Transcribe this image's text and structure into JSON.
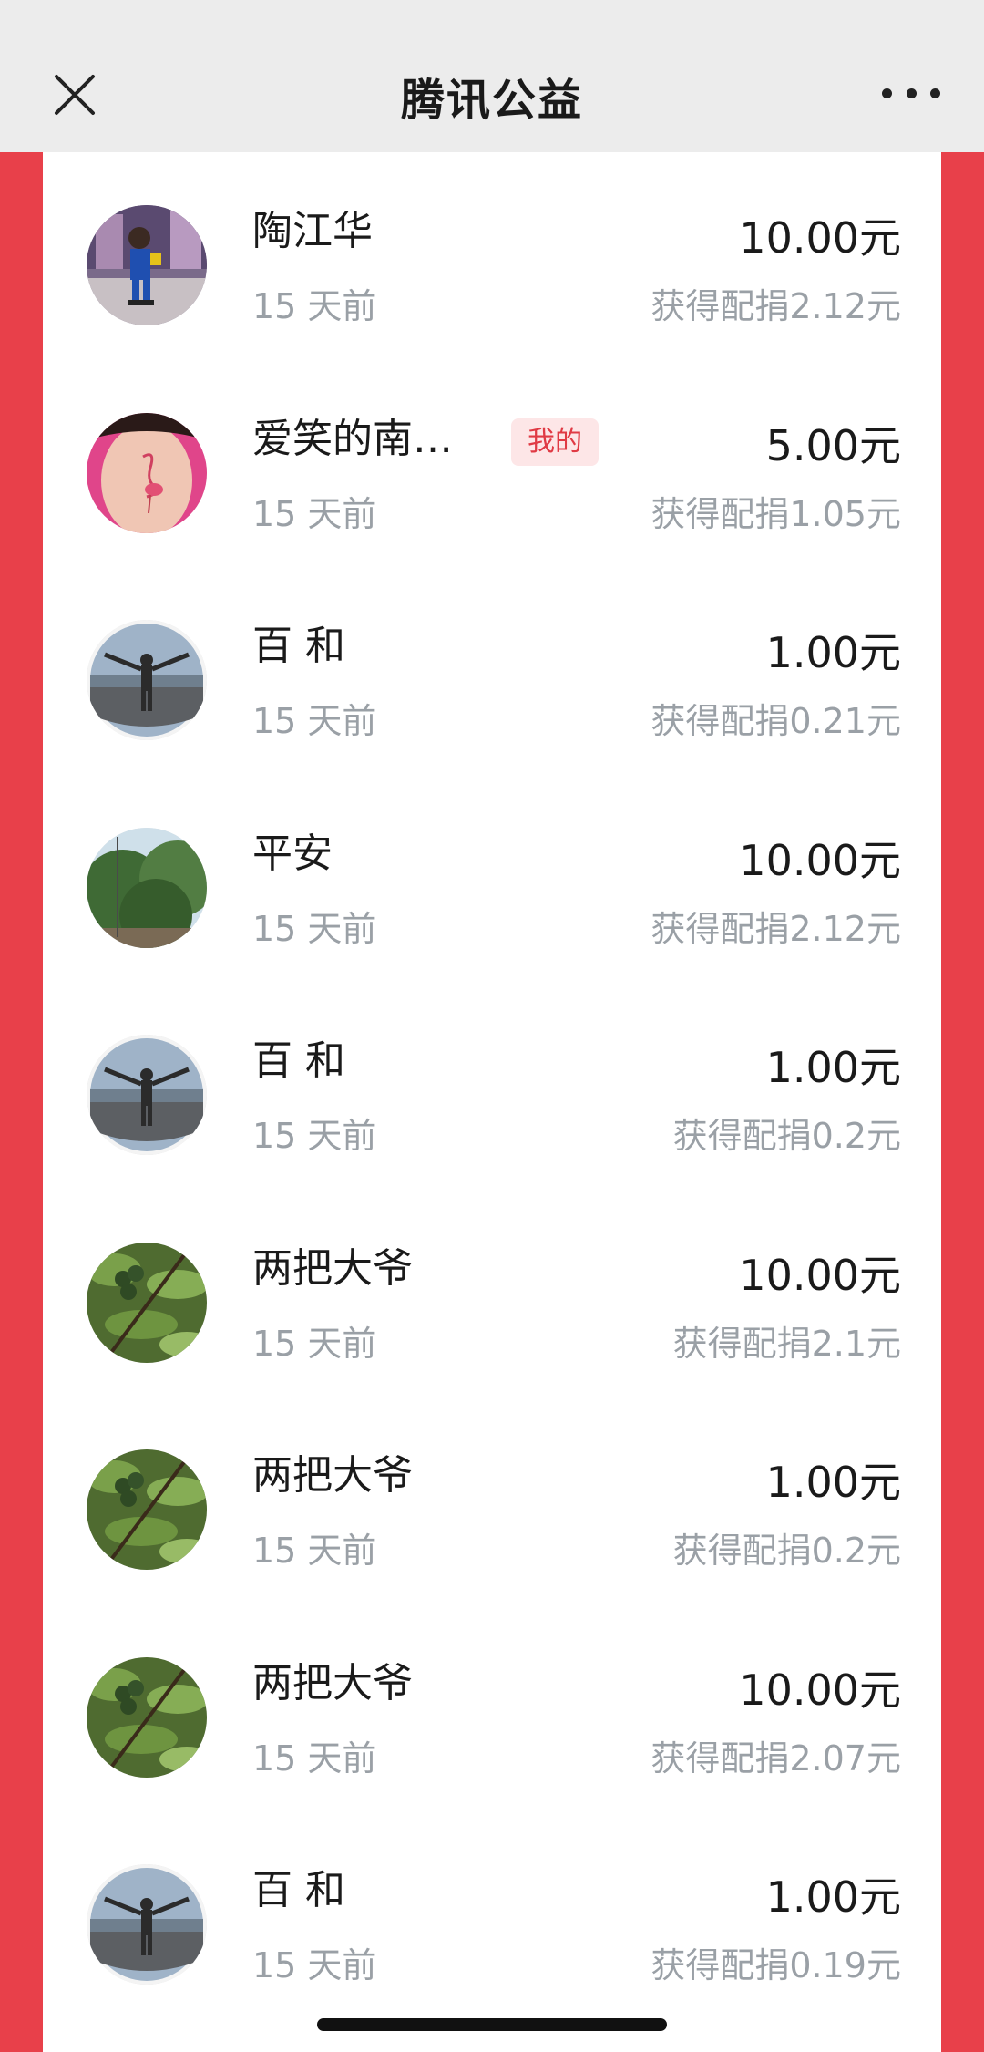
{
  "header": {
    "title": "腾讯公益",
    "close_icon": "close-icon",
    "more_icon": "more-dots-icon"
  },
  "colors": {
    "accent_red": "#e8404a",
    "badge_bg": "#fde6e7",
    "badge_text": "#e03a44",
    "muted_text": "#9aa0a6"
  },
  "donations": [
    {
      "name": "陶江华",
      "time": "15 天前",
      "amount": "10.00元",
      "match": "获得配捐2.12元",
      "badge": "",
      "avatar": "child-photo"
    },
    {
      "name": "爱笑的南…",
      "time": "15 天前",
      "amount": "5.00元",
      "match": "获得配捐1.05元",
      "badge": "我的",
      "avatar": "flamingo-tattoo-photo"
    },
    {
      "name": "百 和",
      "time": "15 天前",
      "amount": "1.00元",
      "match": "获得配捐0.21元",
      "badge": "",
      "avatar": "person-arms-open-photo"
    },
    {
      "name": "平安",
      "time": "15 天前",
      "amount": "10.00元",
      "match": "获得配捐2.12元",
      "badge": "",
      "avatar": "trees-photo"
    },
    {
      "name": "百 和",
      "time": "15 天前",
      "amount": "1.00元",
      "match": "获得配捐0.2元",
      "badge": "",
      "avatar": "person-arms-open-photo"
    },
    {
      "name": "两把大爷",
      "time": "15 天前",
      "amount": "10.00元",
      "match": "获得配捐2.1元",
      "badge": "",
      "avatar": "fruit-tree-photo"
    },
    {
      "name": "两把大爷",
      "time": "15 天前",
      "amount": "1.00元",
      "match": "获得配捐0.2元",
      "badge": "",
      "avatar": "fruit-tree-photo"
    },
    {
      "name": "两把大爷",
      "time": "15 天前",
      "amount": "10.00元",
      "match": "获得配捐2.07元",
      "badge": "",
      "avatar": "fruit-tree-photo"
    },
    {
      "name": "百 和",
      "time": "15 天前",
      "amount": "1.00元",
      "match": "获得配捐0.19元",
      "badge": "",
      "avatar": "person-arms-open-photo"
    }
  ]
}
